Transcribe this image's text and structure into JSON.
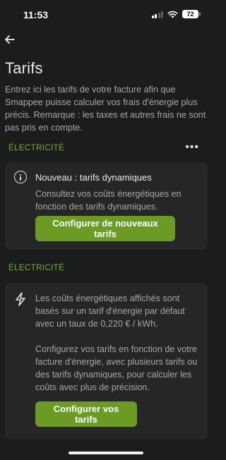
{
  "status_bar": {
    "time": "11:53",
    "battery": "72"
  },
  "header": {
    "title": "Tarifs",
    "intro": "Entrez ici les tarifs de votre facture afin que Smappee puisse calculer vos frais d'énergie plus précis. Remarque : les taxes et autres frais ne sont pas pris en compte."
  },
  "section_1": {
    "label": "ÉLECTRICITÉ",
    "more_label": "•••",
    "card": {
      "icon": "info-icon",
      "heading": "Nouveau : tarifs dynamiques",
      "text": "Consultez vos coûts énergétiques en fonction des tarifs dynamiques.",
      "button_label": "Configurer de nouveaux tarifs"
    }
  },
  "section_2": {
    "label": "ÉLECTRICITÉ",
    "card": {
      "icon": "lightning-icon",
      "text_a": "Les coûts énergétiques affichés sont basés sur un tarif d'énergie par défaut avec un taux de  0,220  € / kWh.",
      "text_b": "Configurez vos tarifs en fonction de votre facture d'énergie, avec plusieurs tarifs ou des tarifs dynamiques, pour calculer les coûts avec plus de précision.",
      "button_label": "Configurer vos tarifs"
    }
  },
  "colors": {
    "accent": "#6b9b25",
    "section_label": "#7ea83a",
    "background": "#1b1c1c",
    "card": "#262626"
  }
}
